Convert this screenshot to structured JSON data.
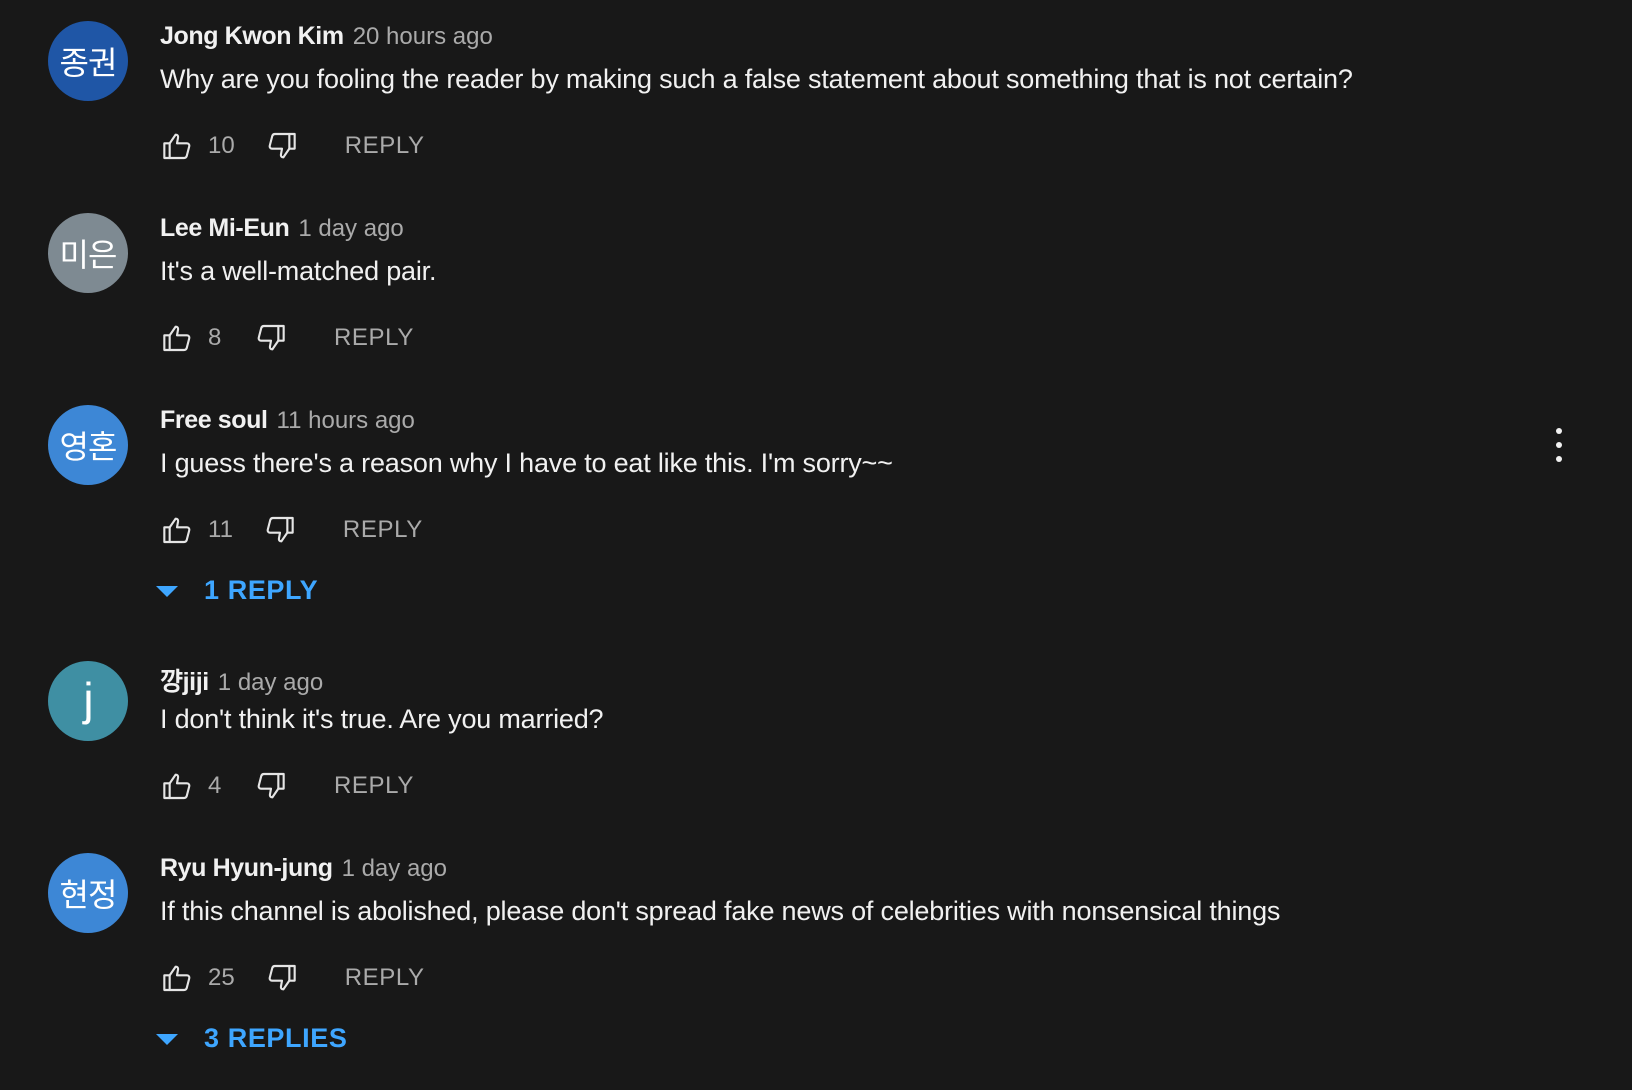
{
  "colors": {
    "background": "#181818",
    "text_primary": "#f1f1f1",
    "text_secondary": "#aaaaaa",
    "link_blue": "#3ea6ff"
  },
  "comments": [
    {
      "avatar_text": "종권",
      "avatar_color": "#1f56a6",
      "author": "Jong Kwon Kim",
      "time": "20 hours ago",
      "text": "Why are you fooling the reader by making such a false statement about something that is not certain?",
      "likes": "10",
      "reply_label": "REPLY",
      "replies_label": ""
    },
    {
      "avatar_text": "미은",
      "avatar_color": "#7e8a92",
      "author": "Lee Mi-Eun",
      "time": "1 day ago",
      "text": "It's a well-matched pair.",
      "likes": "8",
      "reply_label": "REPLY",
      "replies_label": ""
    },
    {
      "avatar_text": "영혼",
      "avatar_color": "#3d87d6",
      "author": "Free soul",
      "time": "11 hours ago",
      "text": "I guess there's a reason why I have to eat like this. I'm sorry~~",
      "likes": "11",
      "reply_label": "REPLY",
      "replies_label": "1 REPLY"
    },
    {
      "avatar_text": "j",
      "avatar_color": "#3f8fa3",
      "author": "꺙jiji",
      "time": "1 day ago",
      "text": "I don't think it's true. Are you married?",
      "likes": "4",
      "reply_label": "REPLY",
      "replies_label": ""
    },
    {
      "avatar_text": "현정",
      "avatar_color": "#3d87d6",
      "author": "Ryu Hyun-jung",
      "time": "1 day ago",
      "text": "If this channel is abolished, please don't spread fake news of celebrities with nonsensical things",
      "likes": "25",
      "reply_label": "REPLY",
      "replies_label": "3 REPLIES"
    }
  ],
  "icons": {
    "like": "thumb-up-icon",
    "dislike": "thumb-down-icon",
    "menu": "more-vert-icon",
    "expand": "caret-down-icon"
  }
}
